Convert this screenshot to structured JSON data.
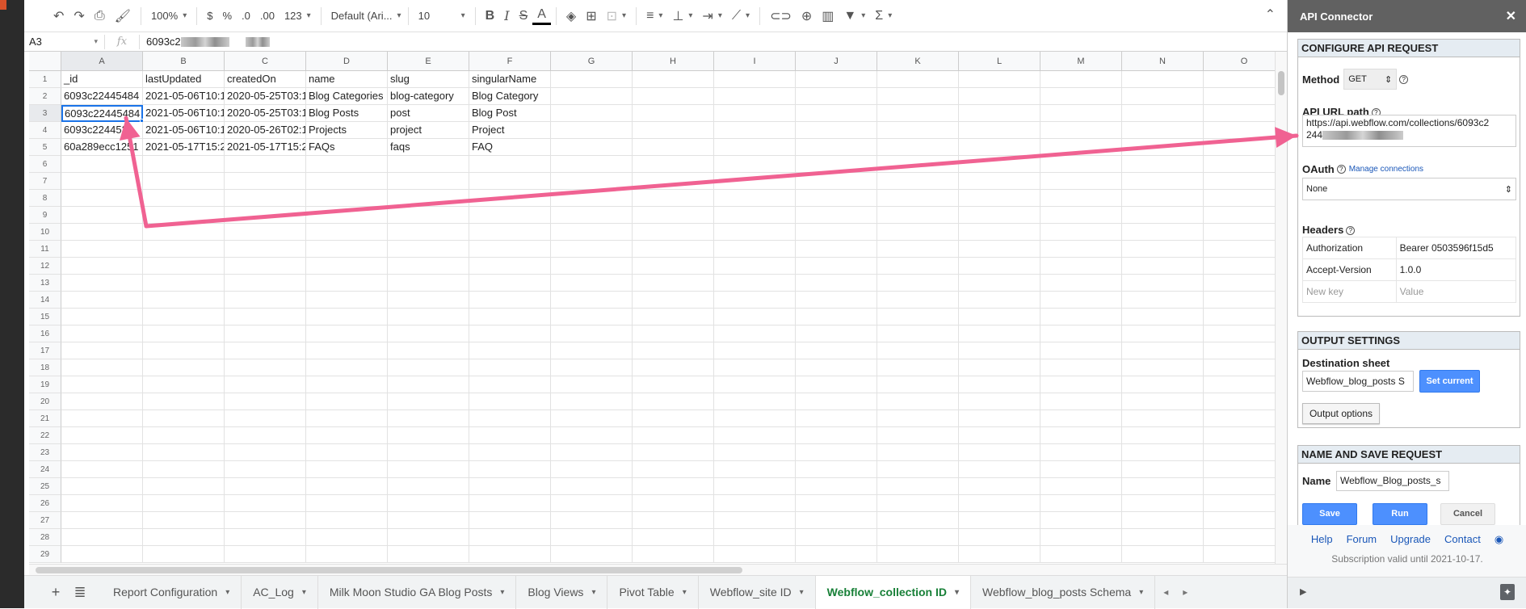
{
  "toolbar": {
    "zoom": "100%",
    "currency": "$",
    "percent": "%",
    "dec_decrease": ".0",
    "dec_increase": ".00",
    "format": "123",
    "font": "Default (Ari...",
    "font_size": "10"
  },
  "formula_bar": {
    "cell_ref": "A3",
    "fx": "fx",
    "value_visible": "6093c2"
  },
  "columns": [
    "A",
    "B",
    "C",
    "D",
    "E",
    "F",
    "G",
    "H",
    "I",
    "J",
    "K",
    "L",
    "M",
    "N",
    "O"
  ],
  "row_count": 29,
  "active_cell": "A3",
  "cells": [
    [
      "_id",
      "lastUpdated",
      "createdOn",
      "name",
      "slug",
      "singularName"
    ],
    [
      "6093c22445484",
      "2021-05-06T10:1",
      "2020-05-25T03:1",
      "Blog Categories",
      "blog-category",
      "Blog Category"
    ],
    [
      "6093c22445484",
      "2021-05-06T10:1",
      "2020-05-25T03:1",
      "Blog Posts",
      "post",
      "Blog Post"
    ],
    [
      "6093c2244534",
      "2021-05-06T10:1",
      "2020-05-26T02:1",
      "Projects",
      "project",
      "Project"
    ],
    [
      "60a289ecc1251",
      "2021-05-17T15:2",
      "2021-05-17T15:2",
      "FAQs",
      "faqs",
      "FAQ"
    ]
  ],
  "sheet_tabs": [
    {
      "label": "Report Configuration",
      "active": false
    },
    {
      "label": "AC_Log",
      "active": false
    },
    {
      "label": "Milk Moon Studio GA Blog Posts",
      "active": false
    },
    {
      "label": "Blog Views",
      "active": false
    },
    {
      "label": "Pivot Table",
      "active": false
    },
    {
      "label": "Webflow_site ID",
      "active": false
    },
    {
      "label": "Webflow_collection ID",
      "active": true
    },
    {
      "label": "Webflow_blog_posts Schema",
      "active": false
    }
  ],
  "panel": {
    "title": "API Connector",
    "configure": {
      "title": "CONFIGURE API REQUEST",
      "method_label": "Method",
      "method_value": "GET",
      "url_label": "API URL path",
      "url_value_line1": "https://api.webflow.com/collections/6093c2",
      "url_value_line2": "244",
      "oauth_label": "OAuth",
      "manage_link": "Manage connections",
      "oauth_value": "None",
      "headers_label": "Headers",
      "headers": [
        {
          "key": "Authorization",
          "value": "Bearer 0503596f15d5"
        },
        {
          "key": "Accept-Version",
          "value": "1.0.0"
        }
      ],
      "new_key_placeholder": "New key",
      "new_value_placeholder": "Value"
    },
    "output": {
      "title": "OUTPUT SETTINGS",
      "dest_label": "Destination sheet",
      "dest_value": "Webflow_blog_posts S",
      "set_current": "Set current",
      "output_options": "Output options"
    },
    "save": {
      "title": "NAME AND SAVE REQUEST",
      "name_label": "Name",
      "name_value": "Webflow_Blog_posts_s",
      "save": "Save",
      "run": "Run",
      "cancel": "Cancel"
    },
    "footer": {
      "links": [
        "Help",
        "Forum",
        "Upgrade",
        "Contact"
      ],
      "subscription": "Subscription valid until 2021-10-17."
    }
  },
  "colors": {
    "arrow": "#f06292",
    "accent": "#4d90fe",
    "active_tab": "#188038",
    "selection": "#1a73e8"
  }
}
